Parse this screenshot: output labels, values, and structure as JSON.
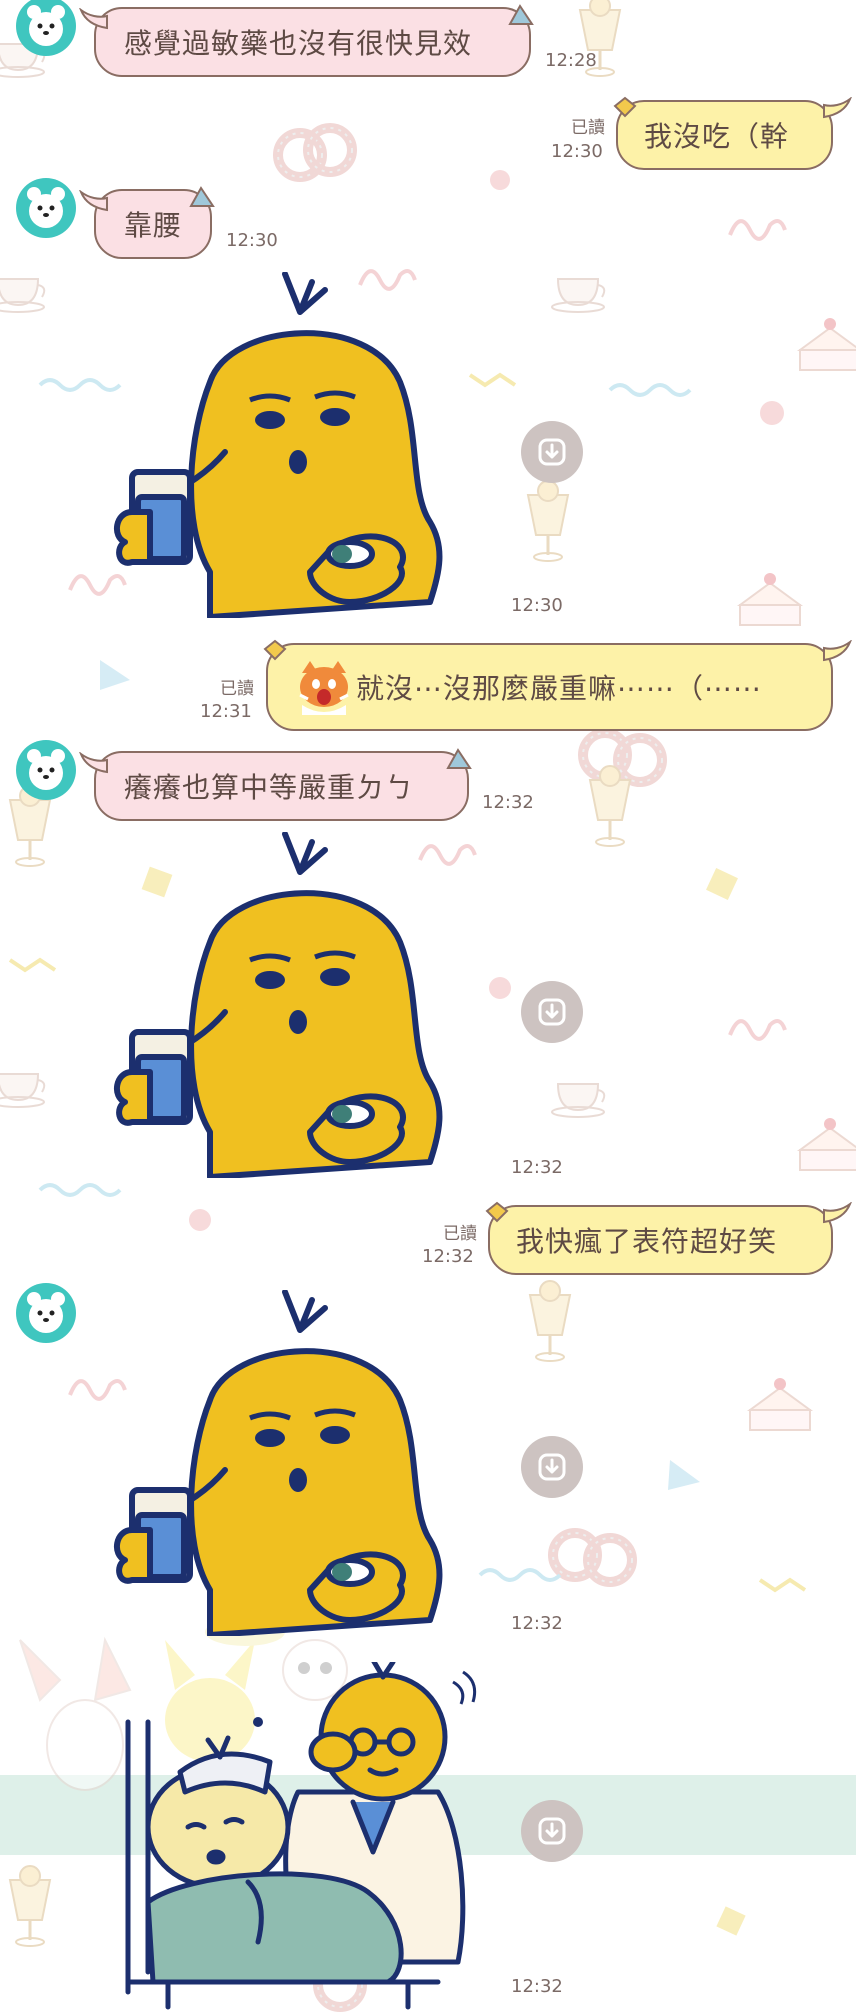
{
  "chat": {
    "messages": [
      {
        "id": "m1",
        "sender": "other",
        "type": "text",
        "text": "感覺過敏藥也沒有很快見效",
        "time": "12:28"
      },
      {
        "id": "m2",
        "sender": "me",
        "type": "text",
        "text": "我沒吃（幹",
        "time": "12:30",
        "read": "已讀"
      },
      {
        "id": "m3",
        "sender": "other",
        "type": "text",
        "text": "靠腰",
        "time": "12:30"
      },
      {
        "id": "m4",
        "sender": "other",
        "type": "sticker",
        "sticker": "yellow-man-drinking-water",
        "time": "12:30"
      },
      {
        "id": "m5",
        "sender": "me",
        "type": "text",
        "text": "就沒⋯沒那麼嚴重嘛⋯⋯（⋯⋯",
        "time": "12:31",
        "read": "已讀",
        "emoji": "shocked-cat-emoji"
      },
      {
        "id": "m6",
        "sender": "other",
        "type": "text",
        "text": "癢癢也算中等嚴重ㄉㄅ",
        "time": "12:32"
      },
      {
        "id": "m7",
        "sender": "other",
        "type": "sticker",
        "sticker": "yellow-man-drinking-water",
        "time": "12:32"
      },
      {
        "id": "m8",
        "sender": "me",
        "type": "text",
        "text": "我快瘋了表符超好笑",
        "time": "12:32",
        "read": "已讀"
      },
      {
        "id": "m9",
        "sender": "other",
        "type": "sticker",
        "sticker": "yellow-man-drinking-water",
        "time": "12:32"
      },
      {
        "id": "m10",
        "sender": "other",
        "type": "sticker",
        "sticker": "doctor-visiting-patient",
        "time": "12:32"
      }
    ]
  },
  "icons": {
    "avatar": "bear-avatar-icon",
    "download": "download-icon"
  },
  "colors": {
    "incoming_bubble": "#fbe0e4",
    "outgoing_bubble": "#fdf2a8",
    "avatar": "#3fc6bf",
    "sticker_yellow": "#f0c020",
    "sticker_outline": "#1c2f6e"
  }
}
